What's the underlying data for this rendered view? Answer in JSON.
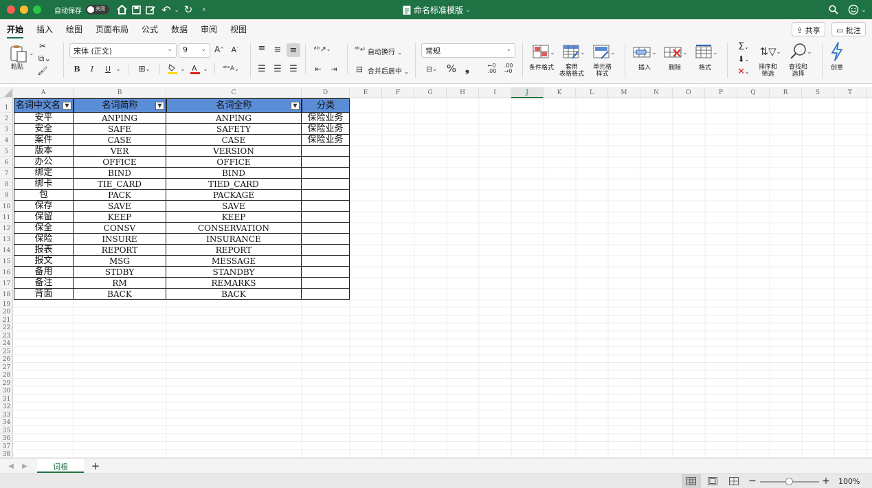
{
  "window": {
    "title": "命名标准模版",
    "autosave_label": "自动保存",
    "autosave_state": "关闭"
  },
  "ribbon_tabs": [
    "开始",
    "插入",
    "绘图",
    "页面布局",
    "公式",
    "数据",
    "审阅",
    "视图"
  ],
  "share_label": "共享",
  "comments_label": "批注",
  "ribbon": {
    "paste_label": "粘贴",
    "font_name": "宋体 (正文)",
    "font_size": "9",
    "wrap_text_label": "自动换行",
    "merge_center_label": "合并后居中",
    "number_format": "常规",
    "conditional_format_label": "条件格式",
    "table_format_label": [
      "套用",
      "表格格式"
    ],
    "cell_style_label": [
      "单元格",
      "样式"
    ],
    "insert_label": "插入",
    "delete_label": "删除",
    "format_label": "格式",
    "sort_filter_label": [
      "排序和",
      "筛选"
    ],
    "find_select_label": [
      "查找和",
      "选择"
    ],
    "ideas_label": "创意",
    "colors": {
      "fill": "#ffd800",
      "font": "#e02020"
    }
  },
  "columns": [
    "A",
    "B",
    "C",
    "D",
    "E",
    "F",
    "G",
    "H",
    "I",
    "J",
    "K",
    "L",
    "M",
    "N",
    "O",
    "P",
    "Q",
    "R",
    "S",
    "T"
  ],
  "row_numbers": [
    "1",
    "2",
    "3",
    "4",
    "5",
    "6",
    "7",
    "8",
    "9",
    "10",
    "11",
    "12",
    "13",
    "14",
    "15",
    "16",
    "17",
    "18",
    "19",
    "20",
    "21",
    "22",
    "23",
    "24",
    "25",
    "26",
    "27",
    "28",
    "29",
    "30",
    "31",
    "32",
    "33",
    "34",
    "35",
    "36",
    "37",
    "38"
  ],
  "table": {
    "headers": [
      "名词中文名",
      "名词简称",
      "名词全称",
      "分类"
    ],
    "rows": [
      [
        "安平",
        "ANPING",
        "ANPING",
        "保险业务"
      ],
      [
        "安全",
        "SAFE",
        "SAFETY",
        "保险业务"
      ],
      [
        "案件",
        "CASE",
        "CASE",
        "保险业务"
      ],
      [
        "版本",
        "VER",
        "VERSION",
        ""
      ],
      [
        "办公",
        "OFFICE",
        "OFFICE",
        ""
      ],
      [
        "绑定",
        "BIND",
        "BIND",
        ""
      ],
      [
        "绑卡",
        "TIE_CARD",
        "TIED_CARD",
        ""
      ],
      [
        "包",
        "PACK",
        "PACKAGE",
        ""
      ],
      [
        "保存",
        "SAVE",
        "SAVE",
        ""
      ],
      [
        "保留",
        "KEEP",
        "KEEP",
        ""
      ],
      [
        "保全",
        "CONSV",
        "CONSERVATION",
        ""
      ],
      [
        "保险",
        "INSURE",
        "INSURANCE",
        ""
      ],
      [
        "报表",
        "REPORT",
        "REPORT",
        ""
      ],
      [
        "报文",
        "MSG",
        "MESSAGE",
        ""
      ],
      [
        "备用",
        "STDBY",
        "STANDBY",
        ""
      ],
      [
        "备注",
        "RM",
        "REMARKS",
        ""
      ],
      [
        "背面",
        "BACK",
        "BACK",
        ""
      ]
    ],
    "header_color": "#5b8cd6"
  },
  "sheet_tabs": [
    "词根"
  ],
  "status": {
    "zoom": "100%"
  }
}
